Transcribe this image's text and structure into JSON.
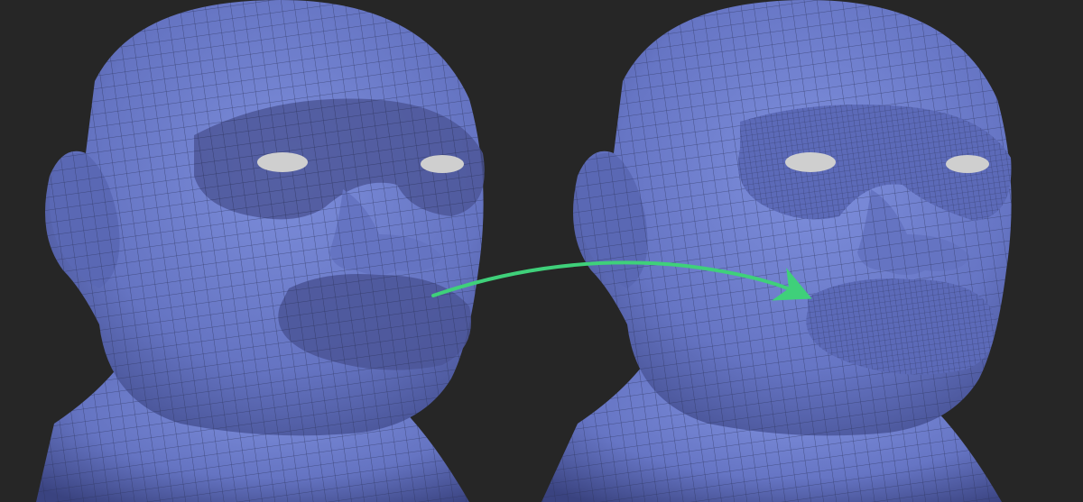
{
  "image": {
    "background_color": "#262626",
    "mesh_color": "#6f80cf",
    "mesh_shadow_color": "#3f4a86",
    "wire_color": "#2b3158",
    "highlight_region_color": "#4d5799",
    "eye_color": "#cfcfcf",
    "arrow_color": "#3fd07a"
  },
  "panels": [
    {
      "name": "left-head-lowres-mesh",
      "variant": "polygroups-highlighted"
    },
    {
      "name": "right-head-dense-mesh",
      "variant": "subdivided-regions"
    }
  ],
  "arrow": {
    "icon": "curved-arrow-icon",
    "direction": "left-to-right"
  }
}
